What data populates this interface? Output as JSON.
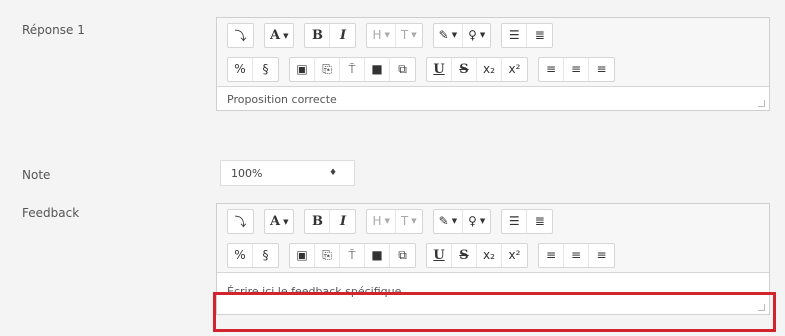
{
  "answer": {
    "label": "Réponse 1",
    "text": "Proposition correcte"
  },
  "grade": {
    "label": "Note",
    "value": "100%"
  },
  "feedback": {
    "label": "Feedback",
    "text": "Écrire ici le feedback spécifique"
  },
  "toolbar": {
    "row1": [
      [
        "⤵"
      ],
      [
        "A▾"
      ],
      [
        "B",
        "I"
      ],
      [
        "H▾",
        "T▾"
      ],
      [
        "✎▾",
        "♀▾"
      ],
      [
        "≡",
        "≣"
      ]
    ],
    "row2": [
      [
        "🔗",
        "⛓"
      ],
      [
        "▣",
        "⎘",
        "🎤",
        "■",
        "⧉"
      ],
      [
        "U",
        "S",
        "x₂",
        "x²"
      ],
      [
        "≡",
        "≡",
        "≡"
      ]
    ]
  },
  "colors": {
    "highlight": "#d1242f"
  }
}
